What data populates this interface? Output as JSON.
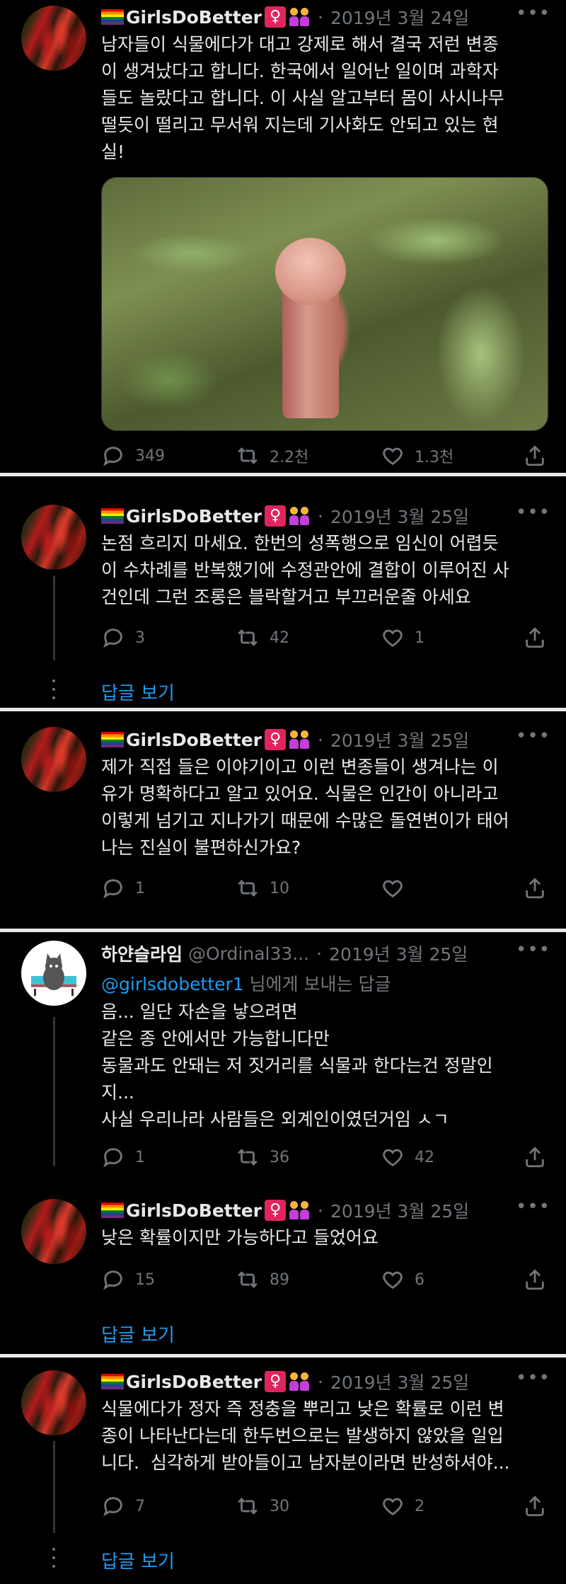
{
  "tweets": [
    {
      "name": "GirlsDoBetter",
      "time": "2019년 3월 24일",
      "text": "남자들이 식물에다가 대고 강제로 해서 결국 저런 변종\n이 생겨났다고 합니다. 한국에서 일어난 일이며 과학자\n들도 놀랐다고 합니다. 이 사실 알고부터 몸이 사시나무\n떨듯이 떨리고 무서워 지는데 기사화도 안되고 있는 현\n실!",
      "replies": "349",
      "retweets": "2.2천",
      "likes": "1.3천"
    },
    {
      "name": "GirlsDoBetter",
      "time": "2019년 3월 25일",
      "text": "논점 흐리지 마세요. 한번의 성폭행으로 임신이 어렵듯\n이 수차례를 반복했기에 수정관안에 결합이 이루어진 사\n건인데 그런 조롱은 블락할거고 부끄러운줄 아세요",
      "replies": "3",
      "retweets": "42",
      "likes": "1",
      "show_replies": "답글 보기"
    },
    {
      "name": "GirlsDoBetter",
      "time": "2019년 3월 25일",
      "text": "제가 직접 들은 이야기이고 이런 변종들이 생겨나는 이\n유가 명확하다고 알고 있어요. 식물은 인간이 아니라고\n이렇게 넘기고 지나가기 때문에 수많은 돌연변이가 태어\n나는 진실이 불편하신가요?",
      "replies": "1",
      "retweets": "10",
      "likes": ""
    },
    {
      "name": "하얀슬라임",
      "handle": "@Ordinal33...",
      "time": "2019년 3월 25일",
      "replying_to": "@girlsdobetter1",
      "replying_suffix": " 님에게 보내는 답글",
      "text": "음... 일단 자손을 낳으려면\n같은 종 안에서만 가능합니다만\n동물과도 안돼는 저 짓거리를 식물과 한다는건 정말인\n지...\n사실 우리나라 사람들은 외계인이였던거임 ㅅㄱ",
      "replies": "1",
      "retweets": "36",
      "likes": "42"
    },
    {
      "name": "GirlsDoBetter",
      "time": "2019년 3월 25일",
      "text": "낮은 확률이지만 가능하다고 들었어요",
      "replies": "15",
      "retweets": "89",
      "likes": "6",
      "show_replies": "답글 보기"
    },
    {
      "name": "GirlsDoBetter",
      "time": "2019년 3월 25일",
      "text": "식물에다가 정자 즉 정충을 뿌리고 낮은 확률로 이런 변\n종이 나타난다는데 한두번으로는 발생하지 않았을 일입\n니다.  심각하게 받아들이고 남자분이라면 반성하셔야...",
      "replies": "7",
      "retweets": "30",
      "likes": "2",
      "show_replies": "답글 보기"
    }
  ],
  "icons": {
    "reply": "reply-icon",
    "retweet": "retweet-icon",
    "like": "heart-icon",
    "share": "share-icon",
    "more": "more-icon"
  },
  "colors": {
    "link": "#1d9bf0",
    "muted": "#71767b",
    "text": "#e7e9ea",
    "background": "#000000"
  }
}
